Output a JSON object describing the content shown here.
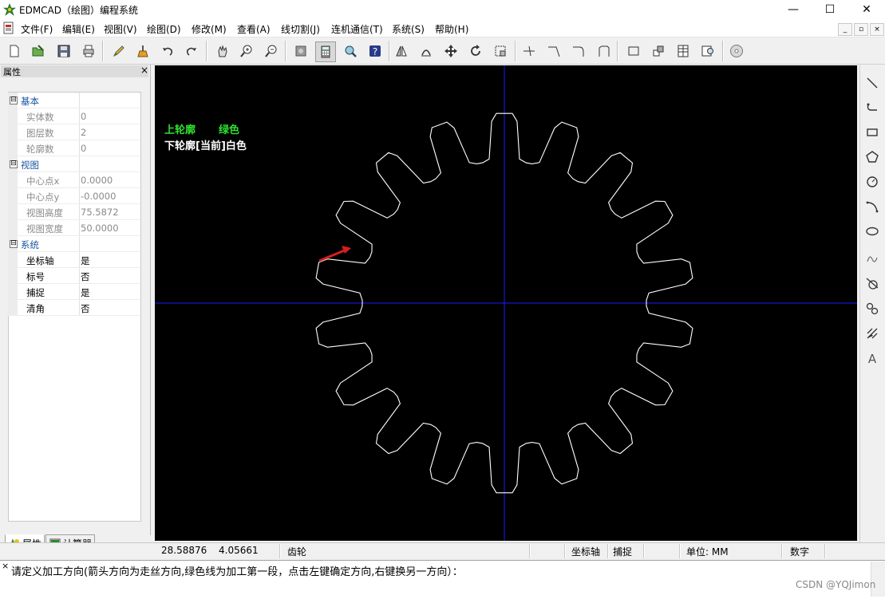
{
  "window": {
    "title": "EDMCAD（绘图）编程系统",
    "min": "—",
    "max": "☐",
    "close": "✕"
  },
  "menu": [
    "文件(F)",
    "编辑(E)",
    "视图(V)",
    "绘图(D)",
    "修改(M)",
    "查看(A)",
    "线切割(J)",
    "连机通信(T)",
    "系统(S)",
    "帮助(H)"
  ],
  "mdi_controls": [
    "_",
    "▫",
    "×"
  ],
  "properties": {
    "title": "属性",
    "close": "×",
    "groups": [
      {
        "label": "基本",
        "rows": [
          {
            "name": "实体数",
            "value": "0"
          },
          {
            "name": "图层数",
            "value": "2"
          },
          {
            "name": "轮廓数",
            "value": "0"
          }
        ]
      },
      {
        "label": "视图",
        "rows": [
          {
            "name": "中心点x",
            "value": "0.0000"
          },
          {
            "name": "中心点y",
            "value": "-0.0000"
          },
          {
            "name": "视图高度",
            "value": "75.5872"
          },
          {
            "name": "视图宽度",
            "value": "50.0000"
          }
        ]
      },
      {
        "label": "系统",
        "rows": [
          {
            "name": "坐标轴",
            "value": "是"
          },
          {
            "name": "标号",
            "value": "否"
          },
          {
            "name": "捕捉",
            "value": "是"
          },
          {
            "name": "清角",
            "value": "否"
          }
        ]
      }
    ],
    "toggle": "⊟",
    "tabs": [
      "属性",
      "计算器"
    ]
  },
  "canvas": {
    "upper_label": "上轮廓",
    "upper_color_label": "绿色",
    "lower_label": "下轮廓[当前]白色",
    "gear_teeth": 18,
    "colors": {
      "background": "#000000",
      "axes": "#1a1aff",
      "profile": "#ffffff",
      "legend_green": "#2fe02f",
      "arrow": "#d81e1e"
    }
  },
  "status": {
    "x": "28.58876",
    "y": "4.05661",
    "entity": "齿轮",
    "axis": "坐标轴",
    "snap": "捕捉",
    "unit": "单位: MM",
    "mode": "数字"
  },
  "command": {
    "prompt": "请定义加工方向(箭头方向为走丝方向,绿色线为加工第一段，点击左键确定方向,右键换另一方向）：",
    "close": "×"
  },
  "watermark": "CSDN @YQJimon"
}
